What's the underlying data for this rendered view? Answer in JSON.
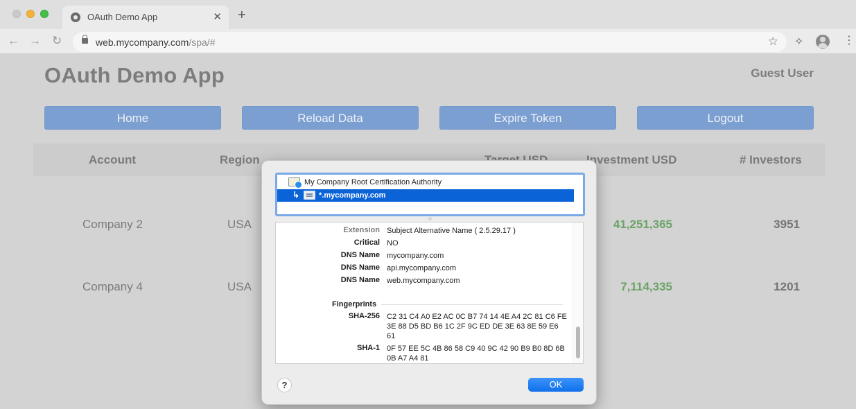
{
  "browser": {
    "tab_title": "OAuth Demo App",
    "tab_close": "✕",
    "new_tab": "+",
    "url_host": "web.mycompany.com",
    "url_path": "/spa/#",
    "icons": [
      "back-arrow-icon",
      "forward-arrow-icon",
      "reload-icon",
      "lock-icon",
      "star-icon",
      "extensions-icon",
      "profile-icon",
      "menu-icon"
    ]
  },
  "app": {
    "title": "OAuth Demo App",
    "user": "Guest User",
    "buttons": {
      "home": "Home",
      "reload": "Reload Data",
      "expire": "Expire Token",
      "logout": "Logout"
    },
    "table": {
      "headers": [
        "Account",
        "Region",
        "Target USD",
        "Investment USD",
        "# Investors"
      ],
      "rows": [
        {
          "account": "Company 2",
          "region": "USA",
          "investment": "41,251,365",
          "investors": "3951"
        },
        {
          "account": "Company 4",
          "region": "USA",
          "investment": "7,114,335",
          "investors": "1201"
        }
      ]
    },
    "colors": {
      "button": "#7c9fd1",
      "positive": "#6aa367"
    }
  },
  "dialog": {
    "chain": {
      "root": "My Company Root Certification Authority",
      "leaf": "*.mycompany.com"
    },
    "details": [
      {
        "label": "Extension",
        "value": "Subject Alternative Name ( 2.5.29.17 )"
      },
      {
        "label": "Critical",
        "value": "NO"
      },
      {
        "label": "DNS Name",
        "value": "mycompany.com"
      },
      {
        "label": "DNS Name",
        "value": "api.mycompany.com"
      },
      {
        "label": "DNS Name",
        "value": "web.mycompany.com"
      }
    ],
    "fingerprints": {
      "section": "Fingerprints",
      "sha256_label": "SHA-256",
      "sha256_value": "C2 31 C4 A0 E2 AC 0C B7 74 14 4E A4 2C 81 C6 FE 3E 88 D5 BD B6 1C 2F 9C ED DE 3E 63 8E 59 E6 61",
      "sha1_label": "SHA-1",
      "sha1_value": "0F 57 EE 5C 4B 86 58 C9 40 9C 42 90 B9 B0 8D 6B 0B A7 A4 81"
    },
    "help": "?",
    "ok": "OK",
    "accent": "#1a7cf2"
  }
}
